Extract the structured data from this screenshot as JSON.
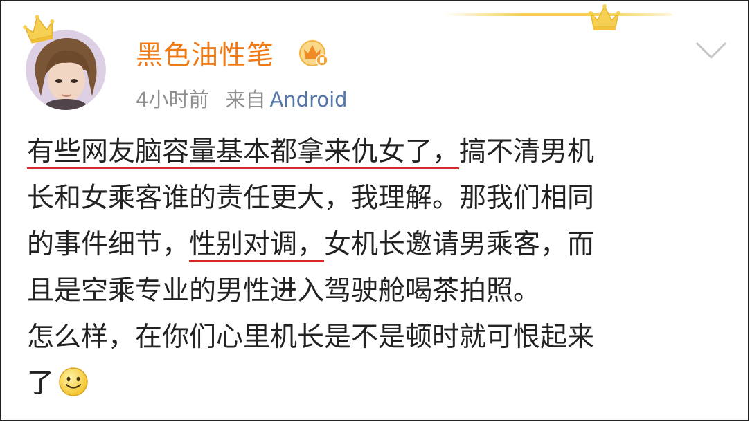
{
  "post": {
    "username": "黑色油性笔",
    "time": "4小时前",
    "source_label": "来自",
    "source": "Android",
    "icons": {
      "avatar_crown": "crown-icon",
      "header_crown": "crown-icon",
      "badge": "vip-crown-badge-icon",
      "more": "chevron-down-icon",
      "emoji": "smile-emoji-icon"
    },
    "colors": {
      "username": "#f07a16",
      "source": "#5577a8",
      "underline": "#d9262c",
      "crown": "#f6cf55"
    },
    "content": {
      "line1_highlight": "有些网友脑容量基本都拿来仇女了，",
      "line1_rest": "搞不清男机",
      "line2": "长和女乘客谁的责任更大，我理解。那我们相同",
      "line3_pre": "的事件细节，",
      "line3_highlight": "性别对调，",
      "line3_post": "女机长邀请男乘客，而",
      "line4": "且是空乘专业的男性进入驾驶舱喝茶拍照。",
      "line5": "怎么样，在你们心里机长是不是顿时就可恨起来",
      "line6": "了"
    }
  }
}
